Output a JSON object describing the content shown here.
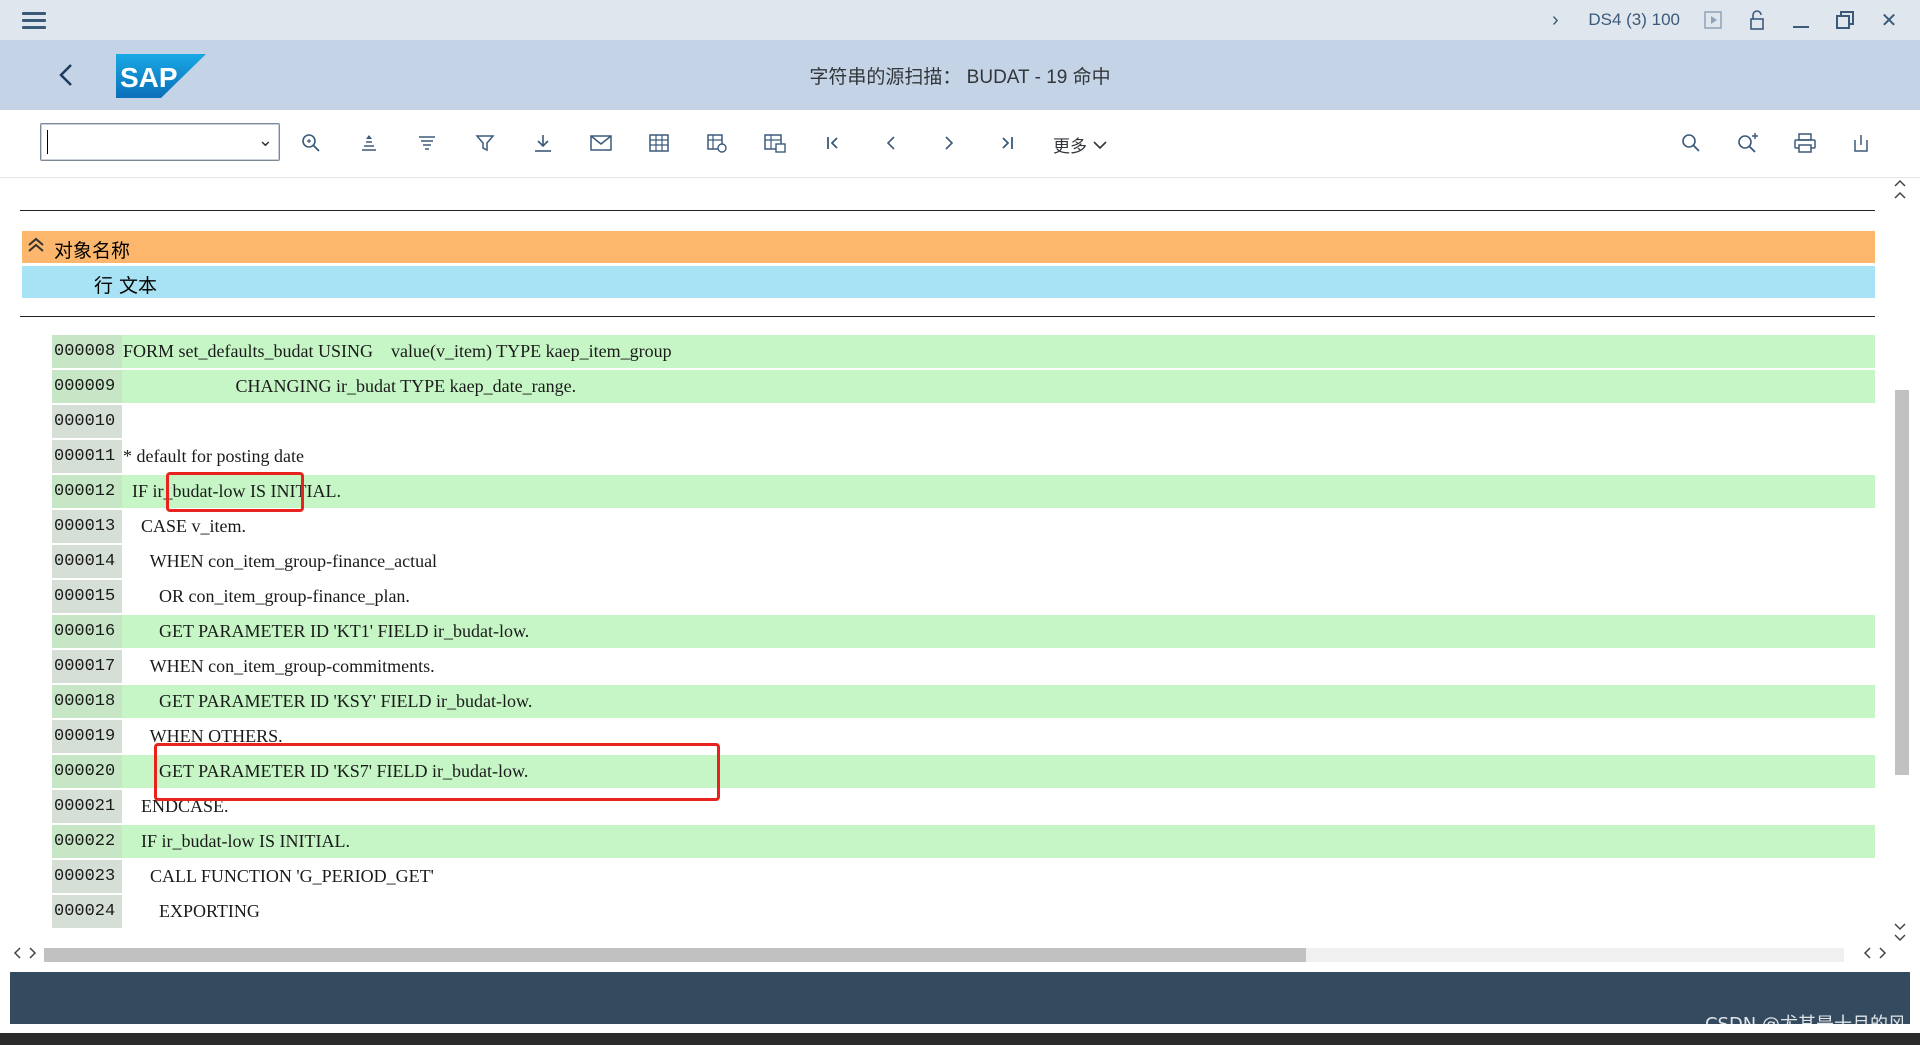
{
  "system_bar": {
    "system_id": "DS4 (3) 100"
  },
  "title_bar": {
    "logo_text": "SAP",
    "title": "字符串的源扫描： BUDAT - 19 命中"
  },
  "toolbar": {
    "combo_value": "",
    "more_label": "更多"
  },
  "header": {
    "object_name_label": "对象名称",
    "line_text_label": "行 文本"
  },
  "code": [
    {
      "num": "000008",
      "text": "FORM set_defaults_budat USING    value(v_item) TYPE kaep_item_group",
      "highlight": true
    },
    {
      "num": "000009",
      "text": "                         CHANGING ir_budat TYPE kaep_date_range.",
      "highlight": true
    },
    {
      "num": "000010",
      "text": "",
      "highlight": false
    },
    {
      "num": "000011",
      "text": "* default for posting date",
      "highlight": false
    },
    {
      "num": "000012",
      "text": "  IF ir_budat-low IS INITIAL.",
      "highlight": true
    },
    {
      "num": "000013",
      "text": "    CASE v_item.",
      "highlight": false
    },
    {
      "num": "000014",
      "text": "      WHEN con_item_group-finance_actual",
      "highlight": false
    },
    {
      "num": "000015",
      "text": "        OR con_item_group-finance_plan.",
      "highlight": false
    },
    {
      "num": "000016",
      "text": "        GET PARAMETER ID 'KT1' FIELD ir_budat-low.",
      "highlight": true
    },
    {
      "num": "000017",
      "text": "      WHEN con_item_group-commitments.",
      "highlight": false
    },
    {
      "num": "000018",
      "text": "        GET PARAMETER ID 'KSY' FIELD ir_budat-low.",
      "highlight": true
    },
    {
      "num": "000019",
      "text": "      WHEN OTHERS.",
      "highlight": false
    },
    {
      "num": "000020",
      "text": "        GET PARAMETER ID 'KS7' FIELD ir_budat-low.",
      "highlight": true
    },
    {
      "num": "000021",
      "text": "    ENDCASE.",
      "highlight": false
    },
    {
      "num": "000022",
      "text": "    IF ir_budat-low IS INITIAL.",
      "highlight": true
    },
    {
      "num": "000023",
      "text": "      CALL FUNCTION 'G_PERIOD_GET'",
      "highlight": false
    },
    {
      "num": "000024",
      "text": "        EXPORTING",
      "highlight": false
    }
  ],
  "watermark": "CSDN @尤其是十月的风"
}
